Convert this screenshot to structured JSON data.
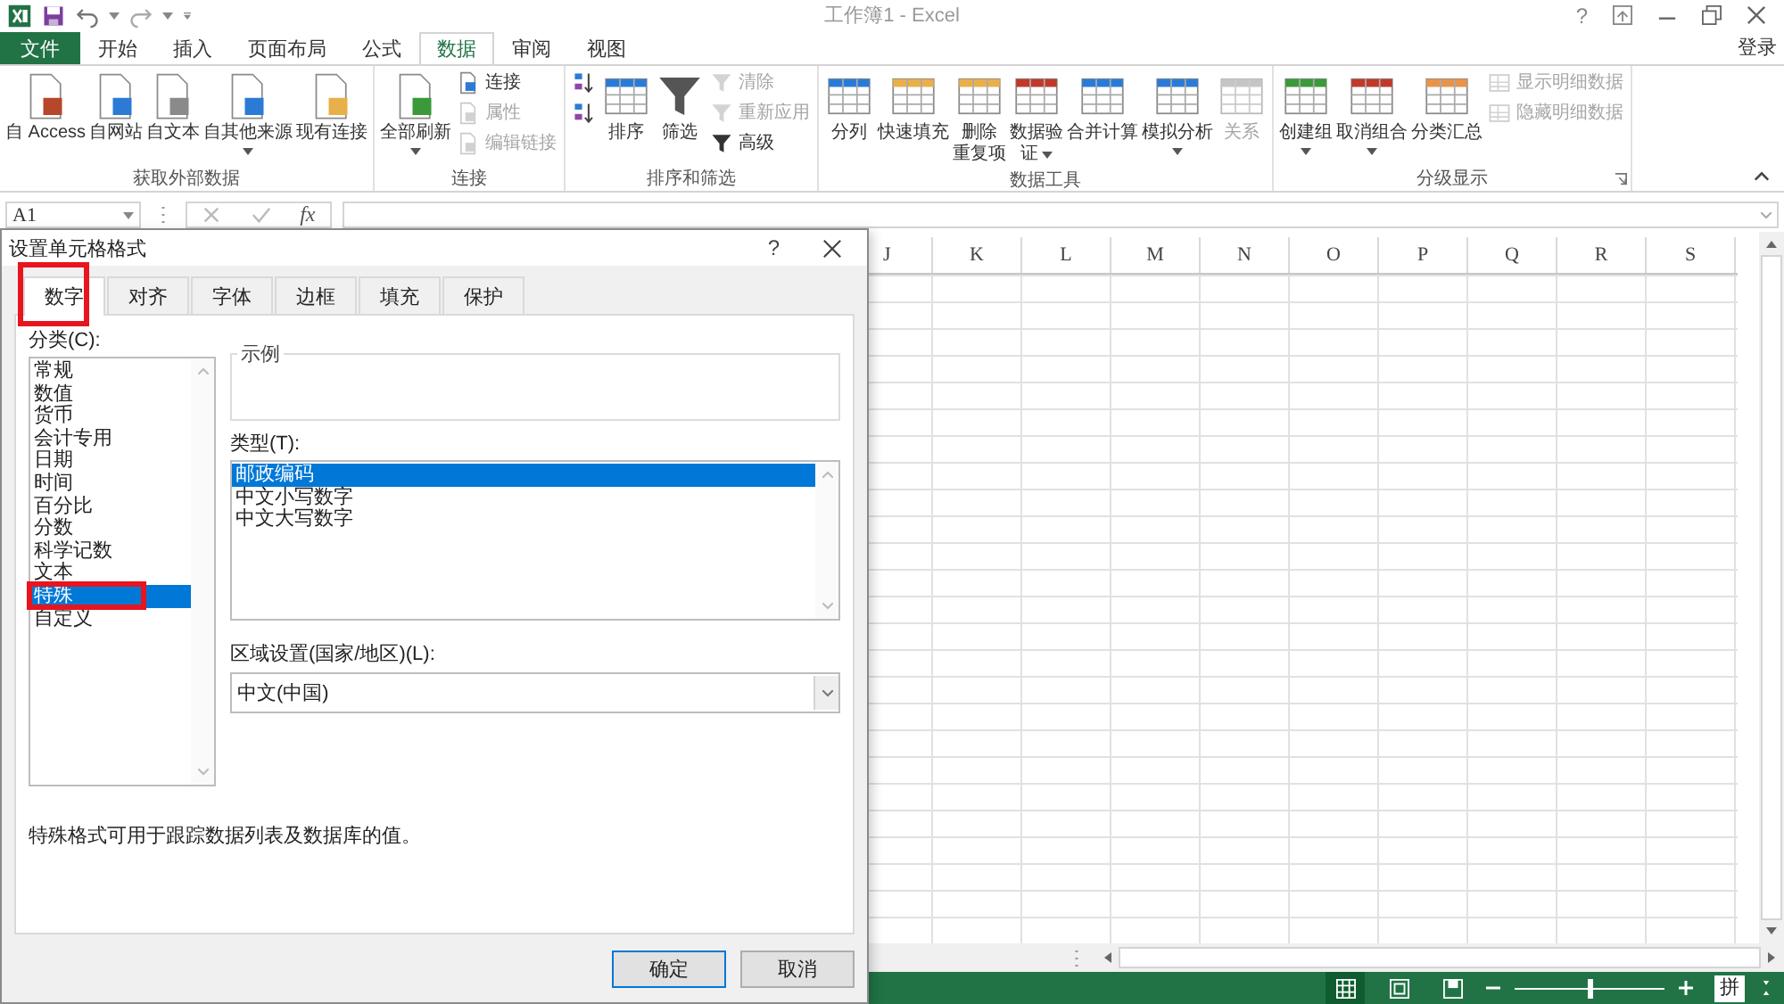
{
  "title_bar": {
    "title": "工作簿1 - Excel",
    "help": "?"
  },
  "ribbon_tabs": [
    {
      "label": "文件",
      "kind": "file",
      "selected": false
    },
    {
      "label": "开始",
      "kind": "tab",
      "selected": false
    },
    {
      "label": "插入",
      "kind": "tab",
      "selected": false
    },
    {
      "label": "页面布局",
      "kind": "tab",
      "selected": false
    },
    {
      "label": "公式",
      "kind": "tab",
      "selected": false
    },
    {
      "label": "数据",
      "kind": "tab",
      "selected": true
    },
    {
      "label": "审阅",
      "kind": "tab",
      "selected": false
    },
    {
      "label": "视图",
      "kind": "tab",
      "selected": false
    }
  ],
  "account": "登录",
  "ribbon_groups": [
    {
      "label": "获取外部数据",
      "launcher": false,
      "items": [
        {
          "kind": "large",
          "lines": [
            "自 Access"
          ],
          "dropdown": false,
          "disabled": false
        },
        {
          "kind": "large",
          "lines": [
            "自网站"
          ],
          "dropdown": false,
          "disabled": false
        },
        {
          "kind": "large",
          "lines": [
            "自文本"
          ],
          "dropdown": false,
          "disabled": false
        },
        {
          "kind": "large",
          "lines": [
            "自其他来源"
          ],
          "dropdown": true,
          "disabled": false
        },
        {
          "kind": "large",
          "lines": [
            "现有连接"
          ],
          "dropdown": false,
          "disabled": false
        }
      ]
    },
    {
      "label": "连接",
      "launcher": false,
      "items": [
        {
          "kind": "large",
          "lines": [
            "全部刷新"
          ],
          "dropdown": true,
          "disabled": false
        },
        {
          "kind": "stack",
          "buttons": [
            {
              "label": "连接",
              "disabled": false
            },
            {
              "label": "属性",
              "disabled": true
            },
            {
              "label": "编辑链接",
              "disabled": true
            }
          ]
        }
      ]
    },
    {
      "label": "排序和筛选",
      "launcher": false,
      "items": [
        {
          "kind": "stack",
          "buttons": [
            {
              "disabled": false
            },
            {
              "disabled": false
            }
          ]
        },
        {
          "kind": "large",
          "lines": [
            "排序"
          ],
          "dropdown": false,
          "disabled": false
        },
        {
          "kind": "large",
          "lines": [
            "筛选"
          ],
          "dropdown": false,
          "disabled": false
        },
        {
          "kind": "stack",
          "buttons": [
            {
              "label": "清除",
              "disabled": true
            },
            {
              "label": "重新应用",
              "disabled": true
            },
            {
              "label": "高级",
              "disabled": false
            }
          ]
        }
      ]
    },
    {
      "label": "数据工具",
      "launcher": false,
      "items": [
        {
          "kind": "large",
          "lines": [
            "分列"
          ],
          "dropdown": false,
          "disabled": false
        },
        {
          "kind": "large",
          "lines": [
            "快速填充"
          ],
          "dropdown": false,
          "disabled": false
        },
        {
          "kind": "large",
          "lines": [
            "删除",
            "重复项"
          ],
          "dropdown": false,
          "disabled": false
        },
        {
          "kind": "large",
          "lines": [
            "数据验",
            "证"
          ],
          "dropdown": true,
          "disabled": false
        },
        {
          "kind": "large",
          "lines": [
            "合并计算"
          ],
          "dropdown": false,
          "disabled": false
        },
        {
          "kind": "large",
          "lines": [
            "模拟分析"
          ],
          "dropdown": true,
          "disabled": false
        },
        {
          "kind": "large",
          "lines": [
            "关系"
          ],
          "dropdown": false,
          "disabled": true
        }
      ]
    },
    {
      "label": "分级显示",
      "launcher": true,
      "items": [
        {
          "kind": "large",
          "lines": [
            "创建组"
          ],
          "dropdown": true,
          "disabled": false
        },
        {
          "kind": "large",
          "lines": [
            "取消组合"
          ],
          "dropdown": true,
          "disabled": false
        },
        {
          "kind": "large",
          "lines": [
            "分类汇总"
          ],
          "dropdown": false,
          "disabled": false
        },
        {
          "kind": "stack",
          "buttons": [
            {
              "label": "显示明细数据",
              "disabled": true
            },
            {
              "label": "隐藏明细数据",
              "disabled": true
            }
          ]
        }
      ]
    }
  ],
  "formula_bar": {
    "name_box": "A1",
    "function_label": "fx"
  },
  "sheet": {
    "columns": [
      "J",
      "K",
      "L",
      "M",
      "N",
      "O",
      "P",
      "Q",
      "R",
      "S"
    ]
  },
  "status_bar": {
    "views": [
      {
        "kind": "normal",
        "selected": true
      },
      {
        "kind": "layout",
        "selected": false
      },
      {
        "kind": "pagebreak",
        "selected": false
      }
    ],
    "zoom": {
      "level": 0.5
    },
    "ime": "拼"
  },
  "dialog": {
    "title": "设置单元格格式",
    "help": "?",
    "tabs": [
      {
        "label": "数字",
        "selected": true,
        "highlighted": true
      },
      {
        "label": "对齐",
        "selected": false,
        "highlighted": false
      },
      {
        "label": "字体",
        "selected": false,
        "highlighted": false
      },
      {
        "label": "边框",
        "selected": false,
        "highlighted": false
      },
      {
        "label": "填充",
        "selected": false,
        "highlighted": false
      },
      {
        "label": "保护",
        "selected": false,
        "highlighted": false
      }
    ],
    "category_label": "分类(C):",
    "categories": [
      {
        "label": "常规",
        "selected": false,
        "highlighted": false
      },
      {
        "label": "数值",
        "selected": false,
        "highlighted": false
      },
      {
        "label": "货币",
        "selected": false,
        "highlighted": false
      },
      {
        "label": "会计专用",
        "selected": false,
        "highlighted": false
      },
      {
        "label": "日期",
        "selected": false,
        "highlighted": false
      },
      {
        "label": "时间",
        "selected": false,
        "highlighted": false
      },
      {
        "label": "百分比",
        "selected": false,
        "highlighted": false
      },
      {
        "label": "分数",
        "selected": false,
        "highlighted": false
      },
      {
        "label": "科学记数",
        "selected": false,
        "highlighted": false
      },
      {
        "label": "文本",
        "selected": false,
        "highlighted": false
      },
      {
        "label": "特殊",
        "selected": true,
        "highlighted": true
      },
      {
        "label": "自定义",
        "selected": false,
        "highlighted": false
      }
    ],
    "sample_label": "示例",
    "type_label": "类型(T):",
    "types": [
      {
        "label": "邮政编码",
        "selected": true
      },
      {
        "label": "中文小写数字",
        "selected": false
      },
      {
        "label": "中文大写数字",
        "selected": false
      }
    ],
    "locale_label": "区域设置(国家/地区)(L):",
    "locale_value": "中文(中国)",
    "description": "特殊格式可用于跟踪数据列表及数据库的值。",
    "buttons": [
      {
        "label": "确定",
        "default": true
      },
      {
        "label": "取消",
        "default": false
      }
    ]
  }
}
